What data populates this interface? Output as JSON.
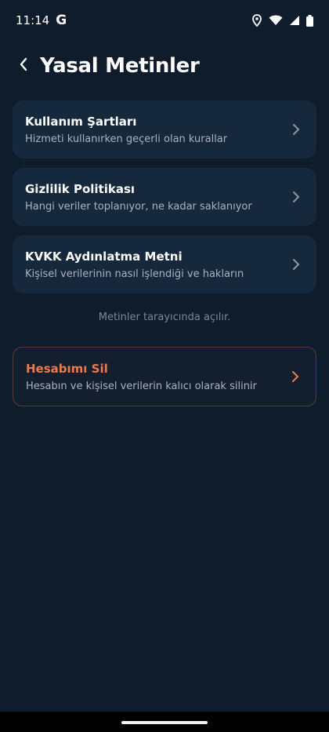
{
  "status_bar": {
    "time": "11:14",
    "g_label": "G"
  },
  "header": {
    "title": "Yasal Metinler"
  },
  "items": [
    {
      "title": "Kullanım Şartları",
      "subtitle": "Hizmeti kullanırken geçerli olan kurallar"
    },
    {
      "title": "Gizlilik Politikası",
      "subtitle": "Hangi veriler toplanıyor, ne kadar saklanıyor"
    },
    {
      "title": "KVKK Aydınlatma Metni",
      "subtitle": "Kişisel verilerinin nasıl işlendiği ve hakların"
    }
  ],
  "note": "Metinler tarayıcında açılır.",
  "danger": {
    "title": "Hesabımı Sil",
    "subtitle": "Hesabın ve kişisel verilerin kalıcı olarak silinir"
  },
  "colors": {
    "background": "#0f1c2c",
    "card": "#16283c",
    "danger_accent": "#f07a4c"
  }
}
